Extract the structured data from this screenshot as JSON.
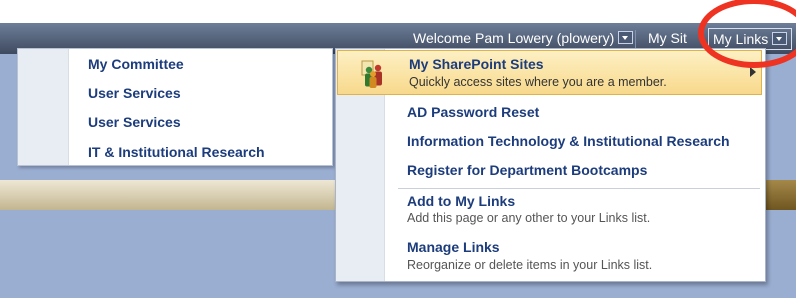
{
  "topbar": {
    "welcome_text": "Welcome Pam Lowery (plowery)",
    "my_site_label": "My Sit",
    "my_links_label": "My Links"
  },
  "left_menu": {
    "items": [
      {
        "label": "My Committee"
      },
      {
        "label": "User Services"
      },
      {
        "label": "User Services"
      },
      {
        "label": "IT & Institutional Research"
      }
    ]
  },
  "my_links_menu": {
    "highlighted": {
      "title": "My SharePoint Sites",
      "description": "Quickly access sites where you are a member.",
      "icon": "people-icon"
    },
    "links": [
      {
        "label": "AD Password Reset"
      },
      {
        "label": "Information Technology & Institutional Research"
      },
      {
        "label": "Register for Department Bootcamps"
      }
    ],
    "actions": [
      {
        "title": "Add to My Links",
        "description": "Add this page or any other to your Links list."
      },
      {
        "title": "Manage Links",
        "description": "Reorganize or delete items in your Links list."
      }
    ]
  },
  "colors": {
    "menu_link": "#1c3c7c",
    "highlight": "#f8d98c",
    "annotation_circle": "#ee3322"
  }
}
